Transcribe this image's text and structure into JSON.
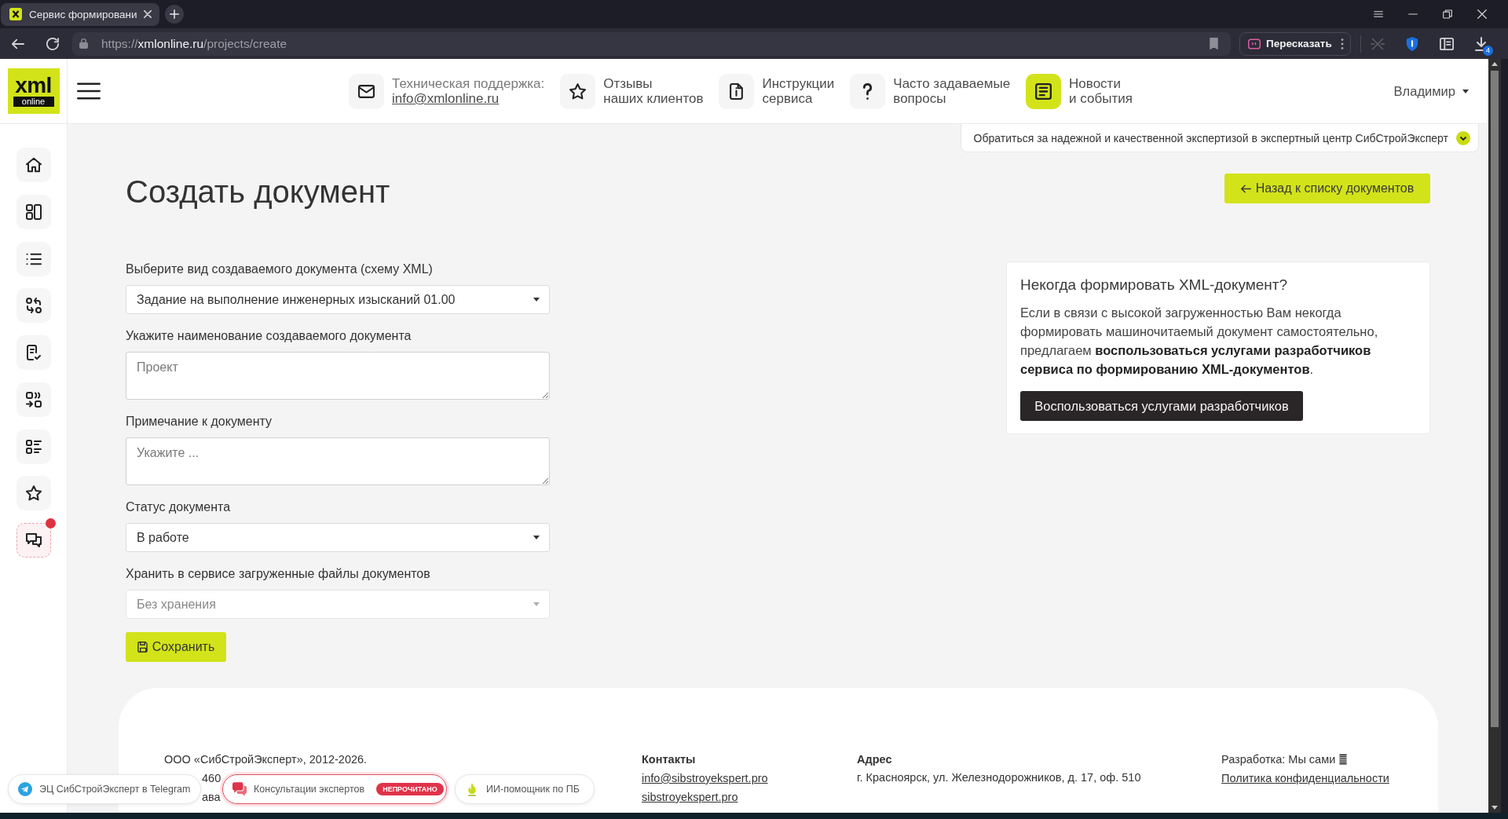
{
  "browser": {
    "tab": {
      "title": "Сервис формировани",
      "selected": true
    },
    "url": {
      "scheme": "https://",
      "host": "xmlonline.ru",
      "path": "/projects/create"
    },
    "summarize_button": "Пересказать",
    "downloads_badge": "4"
  },
  "header": {
    "logo": {
      "top": "xml",
      "bottom": "online"
    },
    "links": [
      {
        "label": "Техническая поддержка:",
        "link": "info@xmlonline.ru",
        "highlighted": false
      },
      {
        "label": "Отзывы\nнаших клиентов",
        "highlighted": false
      },
      {
        "label": "Инструкции\nсервиса",
        "highlighted": false
      },
      {
        "label": "Часто задаваемые\nвопросы",
        "highlighted": false
      },
      {
        "label": "Новости\nи события",
        "highlighted": true
      }
    ],
    "user": "Владимир"
  },
  "sidebar": {
    "items": [
      {
        "notification": false
      },
      {
        "notification": false
      },
      {
        "notification": false
      },
      {
        "notification": false
      },
      {
        "notification": false
      },
      {
        "notification": false
      },
      {
        "notification": false
      },
      {
        "notification": false
      },
      {
        "notification": true
      }
    ]
  },
  "banner": {
    "text": "Обратиться за надежной и качественной экспертизой в экспертный центр СибСтройЭксперт"
  },
  "page": {
    "title": "Создать документ",
    "back_button": "Назад к списку документов"
  },
  "form": {
    "fields": [
      {
        "kind": "select",
        "label": "Выберите вид создаваемого документа (схему XML)",
        "value": "Задание на выполнение инженерных изысканий 01.00",
        "disabled": false
      },
      {
        "kind": "textarea",
        "label": "Укажите наименование создаваемого документа",
        "placeholder": "Проект",
        "disabled": false
      },
      {
        "kind": "textarea",
        "label": "Примечание к документу",
        "placeholder": "Укажите ...",
        "disabled": false
      },
      {
        "kind": "select",
        "label": "Статус документа",
        "value": "В работе",
        "disabled": false
      },
      {
        "kind": "select",
        "label": "Хранить в сервисе загруженные файлы документов",
        "value": "Без хранения",
        "disabled": true
      }
    ],
    "save_button": "Сохранить"
  },
  "info_card": {
    "title": "Некогда формировать XML-документ?",
    "text": "Если в связи с высокой загруженностью Вам некогда формировать машиночитаемый документ самостоятельно, предлагаем **воспользоваться услугами разработчиков сервиса по формированию XML-документов**.",
    "button": "Воспользоваться услугами разработчиков"
  },
  "footer": {
    "company": "ООО «СибСтройЭксперт», 2012-2026.",
    "fragments": [
      "460",
      "ава"
    ],
    "contacts": {
      "heading": "Контакты",
      "links": [
        "info@sibstroyekspert.pro",
        "sibstroyekspert.pro"
      ]
    },
    "address": {
      "heading": "Адрес",
      "text": "г. Красноярск, ул. Железнодорожников, д. 17, оф. 510"
    },
    "credit": "Разработка: Мы сами",
    "policy_link": "Политика конфиденциальности"
  },
  "floating_buttons": [
    {
      "label": "ЭЦ СибСтройЭксперт в Telegram",
      "alert": false
    },
    {
      "label": "Консультации экспертов",
      "badge": "НЕПРОЧИТАНО",
      "alert": true
    },
    {
      "label": "ИИ-помощник по ПБ",
      "alert": false
    }
  ]
}
